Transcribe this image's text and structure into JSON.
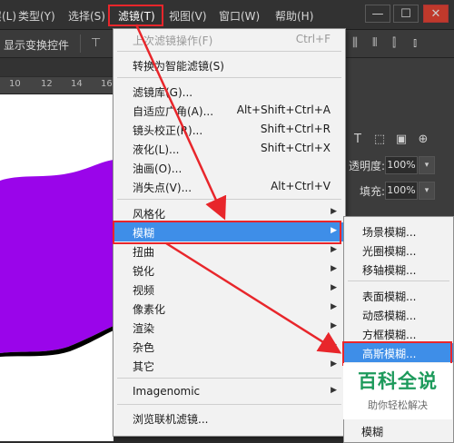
{
  "menubar": {
    "items": [
      "类型(Y)",
      "选择(S)",
      "滤镜(T)",
      "视图(V)",
      "窗口(W)",
      "帮助(H)"
    ],
    "first_partial": "层(L)",
    "win_minimize": "—",
    "win_restore": "☐",
    "win_close": "✕"
  },
  "options_bar": {
    "label": "显示变换控件"
  },
  "ruler": {
    "ticks": [
      "10",
      "12",
      "14",
      "16"
    ]
  },
  "filter_menu": {
    "items": [
      {
        "label": "上次滤镜操作(F)",
        "shortcut": "Ctrl+F",
        "disabled": true
      },
      {
        "label": "转换为智能滤镜(S)",
        "shortcut": ""
      },
      {
        "label": "滤镜库(G)...",
        "shortcut": ""
      },
      {
        "label": "自适应广角(A)...",
        "shortcut": "Alt+Shift+Ctrl+A"
      },
      {
        "label": "镜头校正(R)...",
        "shortcut": "Shift+Ctrl+R"
      },
      {
        "label": "液化(L)...",
        "shortcut": "Shift+Ctrl+X"
      },
      {
        "label": "油画(O)...",
        "shortcut": ""
      },
      {
        "label": "消失点(V)...",
        "shortcut": "Alt+Ctrl+V"
      },
      {
        "label": "风格化",
        "submenu": true
      },
      {
        "label": "模糊",
        "submenu": true,
        "highlighted": true
      },
      {
        "label": "扭曲",
        "submenu": true
      },
      {
        "label": "锐化",
        "submenu": true
      },
      {
        "label": "视频",
        "submenu": true
      },
      {
        "label": "像素化",
        "submenu": true
      },
      {
        "label": "渲染",
        "submenu": true
      },
      {
        "label": "杂色",
        "submenu": true
      },
      {
        "label": "其它",
        "submenu": true
      },
      {
        "label": "Imagenomic",
        "submenu": true
      },
      {
        "label": "浏览联机滤镜...",
        "shortcut": ""
      }
    ]
  },
  "blur_submenu": {
    "items": [
      {
        "label": "场景模糊..."
      },
      {
        "label": "光圈模糊..."
      },
      {
        "label": "移轴模糊..."
      },
      {
        "label": "表面模糊..."
      },
      {
        "label": "动感模糊..."
      },
      {
        "label": "方框模糊..."
      },
      {
        "label": "高斯模糊...",
        "highlighted": true
      },
      {
        "label": "模糊"
      }
    ]
  },
  "layers_panel": {
    "opacity_label": "透明度:",
    "opacity_value": "100%",
    "fill_label": "填充:",
    "fill_value": "100%"
  },
  "watermark": {
    "title": "百科全说",
    "subtitle": "助你轻松解决"
  },
  "colors": {
    "highlight": "#3e8ee8",
    "annotation": "#e8262b",
    "shape": "#9a05ea",
    "watermark": "#1d9a5b"
  }
}
